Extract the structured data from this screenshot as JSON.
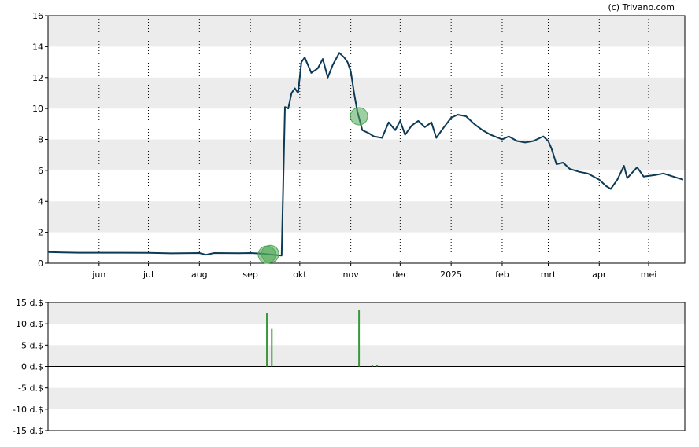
{
  "copyright": "(c) Trivano.com",
  "chart_data": [
    {
      "type": "line",
      "name": "price",
      "ylim": [
        0,
        16
      ],
      "yticks": [
        "0",
        "2",
        "4",
        "6",
        "8",
        "10",
        "12",
        "14",
        "16"
      ],
      "ytick_values": [
        0,
        2,
        4,
        6,
        8,
        10,
        12,
        14,
        16
      ],
      "grid": "horizontal bands, dotted vertical month lines",
      "xlim": [
        "2024-05-01",
        "2025-05-23"
      ],
      "xticks": [
        {
          "date": "2024-06-01",
          "label": "jun"
        },
        {
          "date": "2024-07-01",
          "label": "jul"
        },
        {
          "date": "2024-08-01",
          "label": "aug"
        },
        {
          "date": "2024-09-01",
          "label": "sep"
        },
        {
          "date": "2024-10-01",
          "label": "okt"
        },
        {
          "date": "2024-11-01",
          "label": "nov"
        },
        {
          "date": "2024-12-01",
          "label": "dec"
        },
        {
          "date": "2025-01-01",
          "label": "2025"
        },
        {
          "date": "2025-02-01",
          "label": "feb"
        },
        {
          "date": "2025-03-01",
          "label": "mrt"
        },
        {
          "date": "2025-04-01",
          "label": "apr"
        },
        {
          "date": "2025-05-01",
          "label": "mei"
        }
      ],
      "line_color": "#0d3a56",
      "series": [
        {
          "points": [
            [
              "2024-05-01",
              0.72
            ],
            [
              "2024-05-10",
              0.7
            ],
            [
              "2024-05-20",
              0.68
            ],
            [
              "2024-06-01",
              0.68
            ],
            [
              "2024-06-15",
              0.68
            ],
            [
              "2024-07-01",
              0.67
            ],
            [
              "2024-07-15",
              0.64
            ],
            [
              "2024-08-01",
              0.66
            ],
            [
              "2024-08-05",
              0.55
            ],
            [
              "2024-08-10",
              0.66
            ],
            [
              "2024-08-25",
              0.65
            ],
            [
              "2024-09-01",
              0.66
            ],
            [
              "2024-09-08",
              0.62
            ],
            [
              "2024-09-12",
              0.58
            ],
            [
              "2024-09-20",
              0.5
            ],
            [
              "2024-09-22",
              10.1
            ],
            [
              "2024-09-24",
              10.0
            ],
            [
              "2024-09-26",
              11.0
            ],
            [
              "2024-09-28",
              11.3
            ],
            [
              "2024-09-30",
              11.0
            ],
            [
              "2024-10-02",
              13.0
            ],
            [
              "2024-10-04",
              13.3
            ],
            [
              "2024-10-08",
              12.3
            ],
            [
              "2024-10-12",
              12.6
            ],
            [
              "2024-10-15",
              13.2
            ],
            [
              "2024-10-18",
              12.0
            ],
            [
              "2024-10-21",
              12.8
            ],
            [
              "2024-10-25",
              13.6
            ],
            [
              "2024-10-28",
              13.3
            ],
            [
              "2024-10-30",
              13.0
            ],
            [
              "2024-11-01",
              12.4
            ],
            [
              "2024-11-03",
              11.0
            ],
            [
              "2024-11-05",
              9.8
            ],
            [
              "2024-11-08",
              8.6
            ],
            [
              "2024-11-12",
              8.4
            ],
            [
              "2024-11-15",
              8.2
            ],
            [
              "2024-11-20",
              8.1
            ],
            [
              "2024-11-24",
              9.1
            ],
            [
              "2024-11-28",
              8.6
            ],
            [
              "2024-12-01",
              9.2
            ],
            [
              "2024-12-04",
              8.3
            ],
            [
              "2024-12-08",
              8.9
            ],
            [
              "2024-12-12",
              9.2
            ],
            [
              "2024-12-16",
              8.8
            ],
            [
              "2024-12-20",
              9.1
            ],
            [
              "2024-12-23",
              8.1
            ],
            [
              "2024-12-27",
              8.7
            ],
            [
              "2025-01-01",
              9.4
            ],
            [
              "2025-01-05",
              9.6
            ],
            [
              "2025-01-10",
              9.5
            ],
            [
              "2025-01-15",
              9.0
            ],
            [
              "2025-01-20",
              8.6
            ],
            [
              "2025-01-25",
              8.3
            ],
            [
              "2025-02-01",
              8.0
            ],
            [
              "2025-02-05",
              8.2
            ],
            [
              "2025-02-10",
              7.9
            ],
            [
              "2025-02-15",
              7.8
            ],
            [
              "2025-02-20",
              7.9
            ],
            [
              "2025-02-26",
              8.2
            ],
            [
              "2025-03-01",
              7.9
            ],
            [
              "2025-03-03",
              7.4
            ],
            [
              "2025-03-06",
              6.4
            ],
            [
              "2025-03-10",
              6.5
            ],
            [
              "2025-03-14",
              6.1
            ],
            [
              "2025-03-20",
              5.9
            ],
            [
              "2025-03-25",
              5.8
            ],
            [
              "2025-04-01",
              5.4
            ],
            [
              "2025-04-05",
              5.0
            ],
            [
              "2025-04-08",
              4.8
            ],
            [
              "2025-04-12",
              5.4
            ],
            [
              "2025-04-16",
              6.3
            ],
            [
              "2025-04-18",
              5.5
            ],
            [
              "2025-04-24",
              6.2
            ],
            [
              "2025-04-28",
              5.6
            ],
            [
              "2025-05-05",
              5.7
            ],
            [
              "2025-05-10",
              5.8
            ],
            [
              "2025-05-16",
              5.6
            ],
            [
              "2025-05-22",
              5.4
            ]
          ]
        }
      ],
      "markers": [
        {
          "date": "2024-09-11",
          "value": 0.55,
          "color": "#4fa856"
        },
        {
          "date": "2024-09-13",
          "value": 0.6,
          "color": "#4fa856"
        },
        {
          "date": "2024-11-06",
          "value": 9.5,
          "color": "#4fa856"
        }
      ]
    },
    {
      "type": "bar",
      "name": "dividends",
      "ylim": [
        -15,
        15
      ],
      "yticks": [
        "15 d.$",
        "10 d.$",
        "5 d.$",
        "0 d.$",
        "-5 d.$",
        "-10 d.$",
        "-15 d.$"
      ],
      "ytick_values": [
        15,
        10,
        5,
        0,
        -5,
        -10,
        -15
      ],
      "bar_color": "#3a9a3a",
      "bars": [
        {
          "date": "2024-09-11",
          "value": 12.5
        },
        {
          "date": "2024-09-14",
          "value": 8.8
        },
        {
          "date": "2024-11-06",
          "value": 13.2
        },
        {
          "date": "2024-11-14",
          "value": 0.3
        },
        {
          "date": "2024-11-17",
          "value": 0.4
        }
      ]
    }
  ]
}
